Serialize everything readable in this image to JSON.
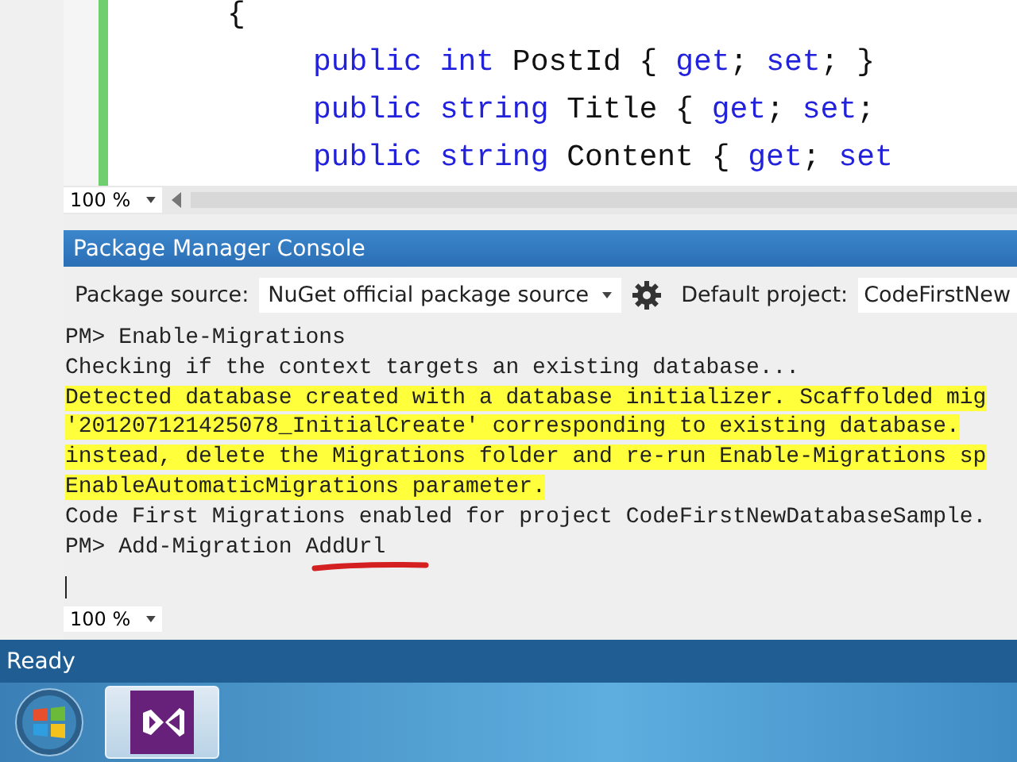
{
  "editor": {
    "code": [
      {
        "tokens": [
          {
            "kind": "plain",
            "text": "{"
          }
        ],
        "children": [
          {
            "tokens": [
              {
                "kind": "keyword",
                "text": "public int"
              },
              {
                "kind": "plain",
                "text": " PostId { "
              },
              {
                "kind": "keyword",
                "text": "get"
              },
              {
                "kind": "plain",
                "text": "; "
              },
              {
                "kind": "keyword",
                "text": "set"
              },
              {
                "kind": "plain",
                "text": "; }"
              }
            ]
          },
          {
            "tokens": [
              {
                "kind": "keyword",
                "text": "public string"
              },
              {
                "kind": "plain",
                "text": " Title { "
              },
              {
                "kind": "keyword",
                "text": "get"
              },
              {
                "kind": "plain",
                "text": "; "
              },
              {
                "kind": "keyword",
                "text": "set"
              },
              {
                "kind": "plain",
                "text": ";"
              }
            ]
          },
          {
            "tokens": [
              {
                "kind": "keyword",
                "text": "public string"
              },
              {
                "kind": "plain",
                "text": " Content { "
              },
              {
                "kind": "keyword",
                "text": "get"
              },
              {
                "kind": "plain",
                "text": "; "
              },
              {
                "kind": "keyword",
                "text": "set"
              }
            ]
          }
        ]
      }
    ],
    "zoom": "100 %"
  },
  "console": {
    "title": "Package Manager Console",
    "toolbar": {
      "source_label": "Package source:",
      "source_value": "NuGet official package source",
      "project_label": "Default project:",
      "project_value": "CodeFirstNew"
    },
    "lines": [
      {
        "text": "PM> Enable-Migrations",
        "highlighted": false
      },
      {
        "text": "Checking if the context targets an existing database...",
        "highlighted": false
      },
      {
        "text": "Detected database created with a database initializer. Scaffolded mig",
        "highlighted": true
      },
      {
        "text": "'201207121425078_InitialCreate' corresponding to existing database.",
        "highlighted": true
      },
      {
        "text": "instead, delete the Migrations folder and re-run Enable-Migrations sp",
        "highlighted": true
      },
      {
        "text": "EnableAutomaticMigrations parameter.",
        "highlighted": true
      },
      {
        "text": "Code First Migrations enabled for project CodeFirstNewDatabaseSample.",
        "highlighted": false
      },
      {
        "text": "PM> Add-Migration AddUrl",
        "highlighted": false
      }
    ],
    "zoom": "100 %"
  },
  "status_bar": {
    "text": "Ready"
  },
  "taskbar": {
    "items": [
      {
        "kind": "start",
        "selected": false
      },
      {
        "kind": "app",
        "selected": true
      }
    ]
  }
}
